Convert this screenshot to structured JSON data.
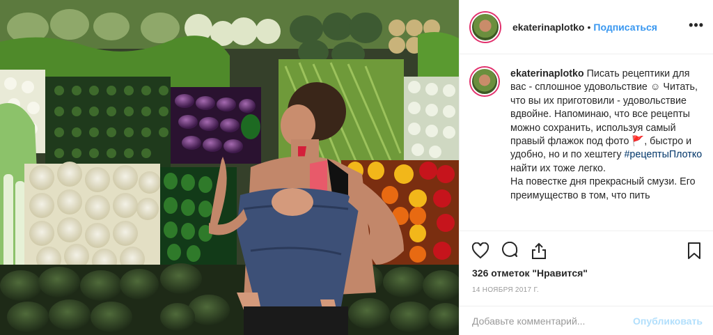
{
  "post": {
    "image_alt": "Woman in a market with a baby in a carrier, smelling a green pepper in front of vegetable displays",
    "author": "ekaterinaplotko",
    "separator": "•",
    "follow_label": "Подписаться",
    "more_label": "•••",
    "caption": {
      "username": "ekaterinaplotko",
      "text_1": " Писать рецептики для вас - сплошное удовольствие ☺ Читать, что вы их приготовили - удовольствие вдвойне. Напоминаю, что все рецепты можно сохранить, используя самый правый флажок под фото ",
      "flag": "🚩",
      "text_2": ", быстро и удобно, но и по хештегу ",
      "hashtag": "#рецептыПлотко",
      "text_3": " найти их тоже легко.",
      "text_4": "На повестке дня прекрасный смузи. Его преимущество в том, что пить"
    },
    "likes": "326 отметок \"Нравится\"",
    "date": "14 НОЯБРЯ 2017 Г.",
    "comment_placeholder": "Добавьте комментарий...",
    "publish_label": "Опубликовать"
  },
  "icons": {
    "like": "heart-icon",
    "comment": "comment-icon",
    "share": "share-icon",
    "save": "bookmark-icon"
  },
  "colors": {
    "link": "#3897f0",
    "hashtag": "#003569",
    "publish_disabled": "#b2dffc",
    "border": "#efefef"
  }
}
